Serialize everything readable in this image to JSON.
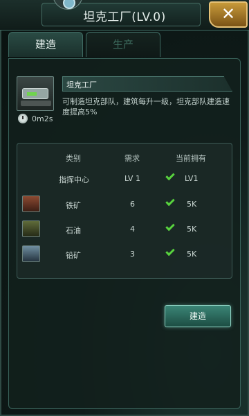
{
  "header": {
    "title": "坦克工厂(LV.0)",
    "close_label": "✕"
  },
  "tabs": [
    {
      "label": "建造",
      "active": true
    },
    {
      "label": "生产",
      "active": false
    }
  ],
  "building": {
    "name": "坦克工厂",
    "description": "可制造坦克部队，建筑每升一级，坦克部队建造速度提高5%",
    "build_time": "0m2s"
  },
  "requirements": {
    "headers": {
      "category": "类别",
      "required": "需求",
      "owned": "当前拥有"
    },
    "rows": [
      {
        "icon": "command-center",
        "name": "指挥中心",
        "required": "LV 1",
        "owned": "LV1",
        "met": true
      },
      {
        "icon": "iron-ore-icon",
        "name": "铁矿",
        "required": "6",
        "owned": "5K",
        "met": true
      },
      {
        "icon": "oil-icon",
        "name": "石油",
        "required": "4",
        "owned": "5K",
        "met": true
      },
      {
        "icon": "lead-ore-icon",
        "name": "铅矿",
        "required": "3",
        "owned": "5K",
        "met": true
      }
    ]
  },
  "actions": {
    "build_label": "建造"
  },
  "colors": {
    "accent": "#3b8576",
    "check": "#58d23e",
    "close": "#c79a3a"
  }
}
